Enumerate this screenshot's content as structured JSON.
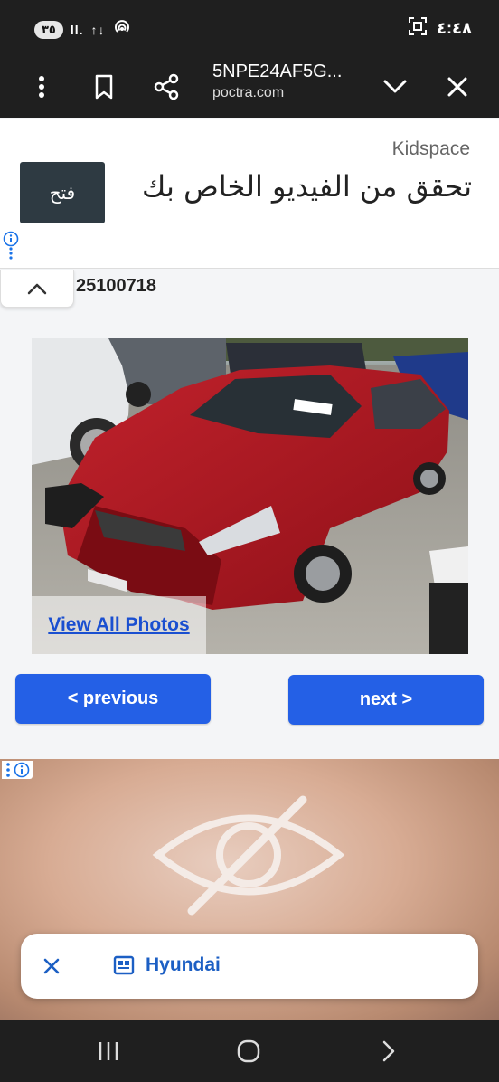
{
  "status_bar": {
    "time": "٤:٤٨",
    "battery": "٣٥",
    "signal": "ll.",
    "network": "↑↓"
  },
  "toolbar": {
    "title": "5NPE24AF5G...",
    "subtitle": "poctra.com",
    "icons": [
      "more-vert-icon",
      "bookmark-icon",
      "share-icon",
      "chevron-down-icon",
      "close-icon"
    ]
  },
  "ad_top": {
    "brand": "Kidspace",
    "text": "تحقق من الفيديو الخاص بك",
    "button": "فتح"
  },
  "lot": {
    "number": "25100718"
  },
  "photo": {
    "view_all": "View All Photos"
  },
  "pagination": {
    "previous": "< previous",
    "next": "next >"
  },
  "snackbar": {
    "text": "Hyundai"
  },
  "colors": {
    "accent": "#2460e6",
    "link": "#1a4fd0",
    "dark_bar": "#1f1f1f",
    "car": "#b01822"
  }
}
